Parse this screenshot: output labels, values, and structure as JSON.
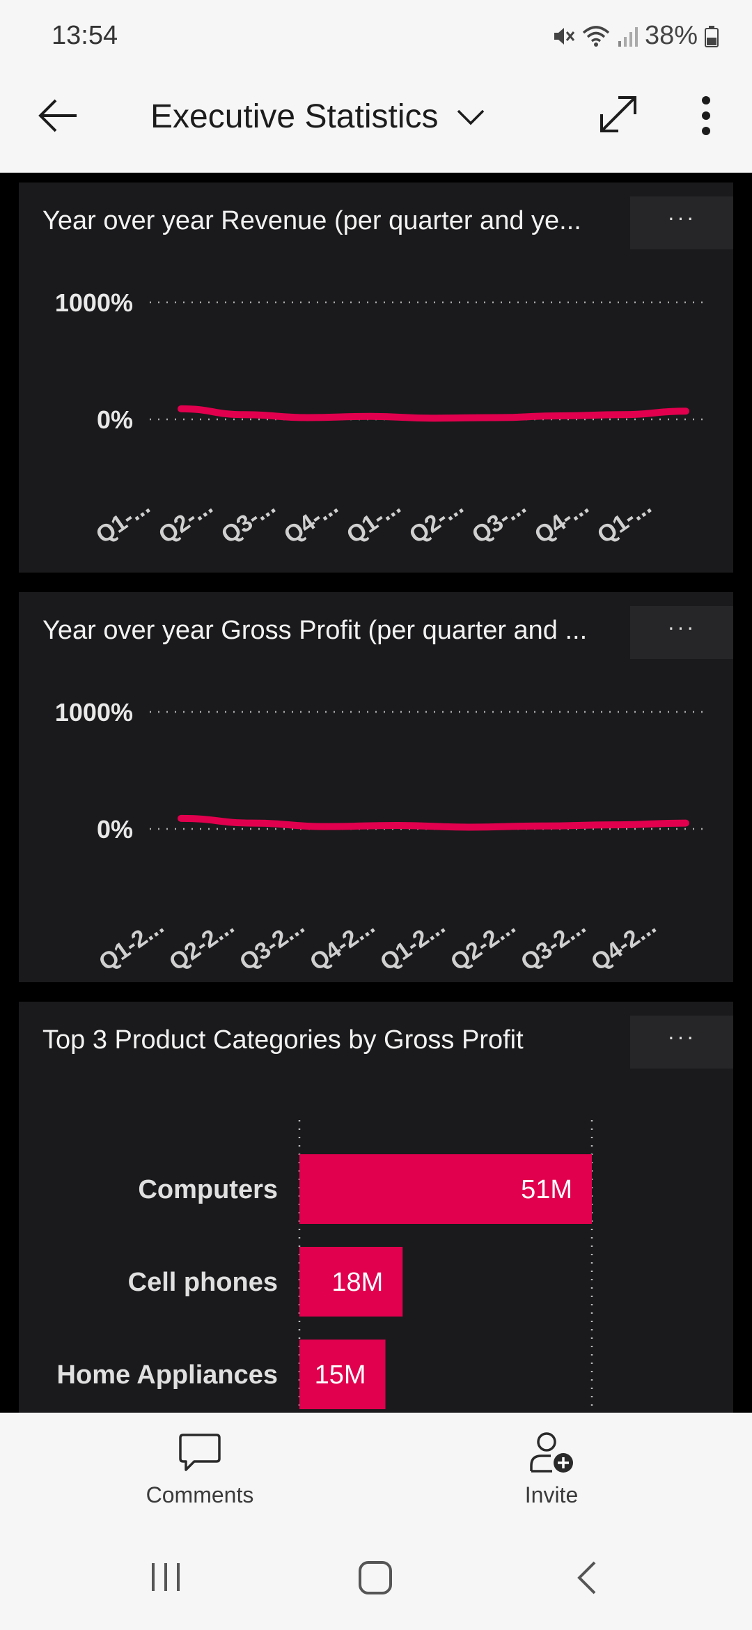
{
  "status": {
    "time": "13:54",
    "battery": "38%"
  },
  "header": {
    "title": "Executive Statistics"
  },
  "cards": [
    {
      "title": "Year over year Revenue (per quarter and ye...",
      "menu": "···",
      "chart_data": {
        "type": "line",
        "title": "Year over year Revenue (per quarter and ye...",
        "yticks": [
          "1000%",
          "0%"
        ],
        "ylim": [
          0,
          1000
        ],
        "categories": [
          "Q1-...",
          "Q2-...",
          "Q3-...",
          "Q4-...",
          "Q1-...",
          "Q2-...",
          "Q3-...",
          "Q4-...",
          "Q1-..."
        ],
        "values": [
          90,
          40,
          15,
          25,
          10,
          15,
          30,
          40,
          70
        ],
        "color": "#e0004d",
        "grid": true
      }
    },
    {
      "title": "Year over year Gross Profit (per quarter and ...",
      "menu": "···",
      "chart_data": {
        "type": "line",
        "title": "Year over year Gross Profit (per quarter and ...",
        "yticks": [
          "1000%",
          "0%"
        ],
        "ylim": [
          0,
          1000
        ],
        "categories": [
          "Q1-2...",
          "Q2-2...",
          "Q3-2...",
          "Q4-2...",
          "Q1-2...",
          "Q2-2...",
          "Q3-2...",
          "Q4-2..."
        ],
        "values": [
          90,
          50,
          20,
          30,
          15,
          25,
          35,
          50
        ],
        "color": "#e0004d",
        "grid": true
      }
    },
    {
      "title": "Top 3 Product Categories by Gross Profit",
      "menu": "···",
      "chart_data": {
        "type": "bar",
        "orientation": "horizontal",
        "title": "Top 3 Product Categories by Gross Profit",
        "categories": [
          "Computers",
          "Cell phones",
          "Home Appliances"
        ],
        "values": [
          51,
          18,
          15
        ],
        "labels": [
          "51M",
          "18M",
          "15M"
        ],
        "xlim": [
          0,
          51
        ],
        "color": "#e0004d"
      }
    }
  ],
  "bottom_nav": {
    "comments": "Comments",
    "invite": "Invite"
  }
}
